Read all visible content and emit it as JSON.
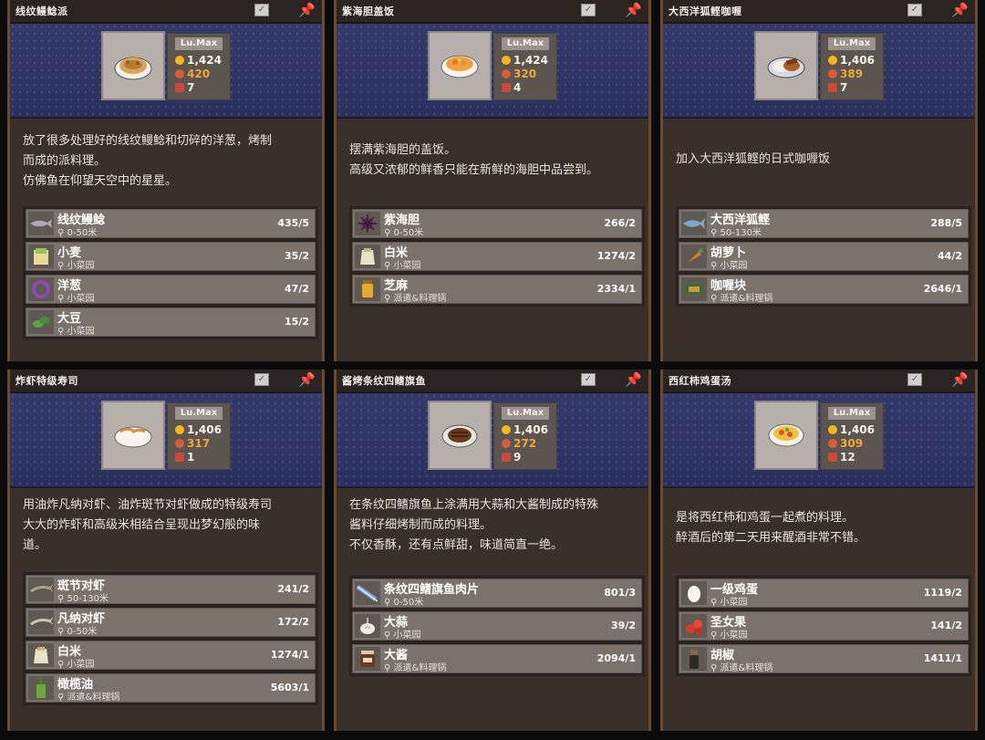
{
  "cards": [
    {
      "title": "线纹鳗鲶派",
      "level": "Lu.Max",
      "price": "1,424",
      "hp": "420",
      "count": "7",
      "description": "放了很多处理好的线纹鳗鲶和切碎的洋葱，烤制\n而成的派料理。\n仿佛鱼在仰望天空中的星星。",
      "ingredients": [
        {
          "name": "线纹鳗鲶",
          "location": "0-50米",
          "count": "435/5"
        },
        {
          "name": "小麦",
          "location": "小菜园",
          "count": "35/2"
        },
        {
          "name": "洋葱",
          "location": "小菜园",
          "count": "47/2"
        },
        {
          "name": "大豆",
          "location": "小菜园",
          "count": "15/2"
        }
      ]
    },
    {
      "title": "紫海胆盖饭",
      "level": "Lu.Max",
      "price": "1,424",
      "hp": "320",
      "count": "4",
      "description": "摆满紫海胆的盖饭。\n高级又浓郁的鲜香只能在新鲜的海胆中品尝到。",
      "ingredients": [
        {
          "name": "紫海胆",
          "location": "0-50米",
          "count": "266/2"
        },
        {
          "name": "白米",
          "location": "小菜园",
          "count": "1274/2"
        },
        {
          "name": "芝麻",
          "location": "派遣&料理锅",
          "count": "2334/1"
        }
      ]
    },
    {
      "title": "大西洋狐鲣咖喱",
      "level": "Lu.Max",
      "price": "1,406",
      "hp": "389",
      "count": "7",
      "description": "加入大西洋狐鲣的日式咖喱饭",
      "ingredients": [
        {
          "name": "大西洋狐鲣",
          "location": "50-130米",
          "count": "288/5"
        },
        {
          "name": "胡萝卜",
          "location": "小菜园",
          "count": "44/2"
        },
        {
          "name": "咖喱块",
          "location": "派遣&料理锅",
          "count": "2646/1"
        }
      ]
    },
    {
      "title": "炸虾特级寿司",
      "level": "Lu.Max",
      "price": "1,406",
      "hp": "317",
      "count": "1",
      "description": "用油炸凡纳对虾、油炸斑节对虾做成的特级寿司\n大大的炸虾和高级米相结合呈现出梦幻般的味\n道。",
      "ingredients": [
        {
          "name": "斑节对虾",
          "location": "50-130米",
          "count": "241/2"
        },
        {
          "name": "凡纳对虾",
          "location": "0-50米",
          "count": "172/2"
        },
        {
          "name": "白米",
          "location": "小菜园",
          "count": "1274/1"
        },
        {
          "name": "橄榄油",
          "location": "派遣&料理锅",
          "count": "5603/1"
        }
      ]
    },
    {
      "title": "酱烤条纹四鳍旗鱼",
      "level": "Lu.Max",
      "price": "1,406",
      "hp": "272",
      "count": "9",
      "description": "在条纹四鳍旗鱼上涂满用大蒜和大酱制成的特殊\n酱料仔细烤制而成的料理。\n不仅香酥，还有点鲜甜，味道简直一绝。",
      "ingredients": [
        {
          "name": "条纹四鳍旗鱼肉片",
          "location": "0-50米",
          "count": "801/3"
        },
        {
          "name": "大蒜",
          "location": "小菜园",
          "count": "39/2"
        },
        {
          "name": "大酱",
          "location": "派遣&料理锅",
          "count": "2094/1"
        }
      ]
    },
    {
      "title": "西红柿鸡蛋汤",
      "level": "Lu.Max",
      "price": "1,406",
      "hp": "309",
      "count": "12",
      "description": "是将西红柿和鸡蛋一起煮的料理。\n醉酒后的第二天用来醒酒非常不错。",
      "ingredients": [
        {
          "name": "一级鸡蛋",
          "location": "小菜园",
          "count": "1119/2"
        },
        {
          "name": "圣女果",
          "location": "小菜园",
          "count": "141/2"
        },
        {
          "name": "胡椒",
          "location": "派遣&料理锅",
          "count": "1411/1"
        }
      ]
    }
  ],
  "colors": {
    "accent_orange": "#f0a63a",
    "coin_gold": "#f4b71f",
    "hero_blue": "#2d3464",
    "panel_brown": "#3a2f29",
    "row_grey": "#7b726b"
  }
}
